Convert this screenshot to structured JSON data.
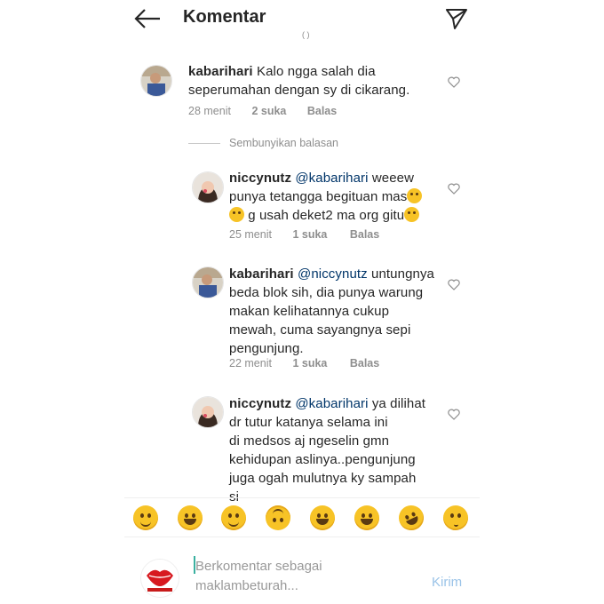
{
  "header": {
    "title": "Komentar",
    "back_icon": "arrow-left-icon",
    "send_icon": "direct-send-icon"
  },
  "comments": [
    {
      "username": "kabarihari",
      "text_lines": [
        "Kalo ngga salah dia",
        "seperumahan dengan sy di cikarang."
      ],
      "time": "28 menit",
      "likes": "2 suka",
      "reply": "Balas"
    }
  ],
  "hide_replies": "Sembunyikan balasan",
  "replies": [
    {
      "username": "niccynutz",
      "mention": "@kabarihari",
      "line1_rest": " weeew",
      "line2": "punya tetangga begituan mas",
      "line3": " g usah deket2 ma org gitu",
      "time": "25 menit",
      "likes": "1 suka",
      "reply": "Balas"
    },
    {
      "username": "kabarihari",
      "mention": "@niccynutz",
      "line1_rest": " untungnya",
      "line2": "beda blok sih, dia punya warung",
      "line3": "makan kelihatannya cukup",
      "line4": "mewah, cuma sayangnya sepi",
      "line5": "pengunjung.",
      "time": "22 menit",
      "likes": "1 suka",
      "reply": "Balas"
    },
    {
      "username": "niccynutz",
      "mention": "@kabarihari",
      "line1_rest": " ya dilihat",
      "line2": "dr tutur katanya selama ini",
      "line3": "di medsos aj ngeselin gmn",
      "line4": "kehidupan aslinya..pengunjung",
      "line5": "juga ogah mulutnya ky sampah",
      "line6": "si"
    }
  ],
  "emoji_bar": [
    "smiling-face",
    "grinning-face",
    "slightly-smiling-face",
    "upside-down-face",
    "grinning-squinting-face",
    "beaming-face",
    "face-with-tears-of-joy",
    "kissing-face"
  ],
  "input": {
    "placeholder_line1": "Berkomentar sebagai",
    "placeholder_line2": "maklambeturah...",
    "submit": "Kirim"
  },
  "colors": {
    "mention": "#003569",
    "meta": "#8e8e8e",
    "submit_disabled": "#9ac3e8"
  }
}
